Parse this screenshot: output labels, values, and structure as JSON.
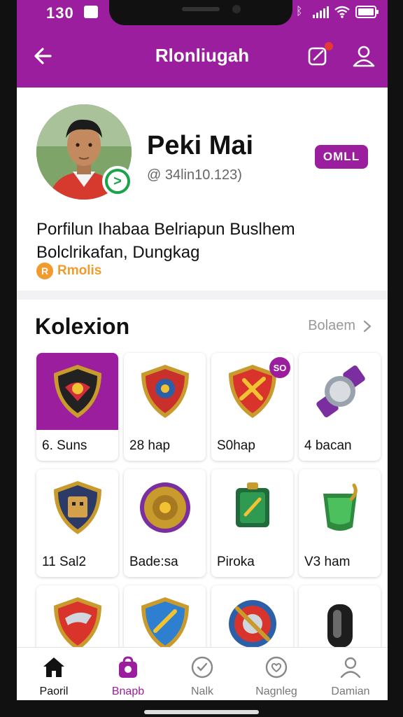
{
  "status_bar": {
    "time": "130"
  },
  "app_bar": {
    "title": "Rlonliugah"
  },
  "profile": {
    "name": "Peki Mai",
    "handle": "@ 34lin10.123)",
    "chip_label": "OMLL",
    "bio_line_1": "Porfilun Ihabaa Belriapun Buslhem",
    "bio_line_2": "Bolclrikafan, Dungkag",
    "tag_label": "Rmolis"
  },
  "collection": {
    "title": "Kolexion",
    "see_all": "Bolaem",
    "items": [
      {
        "label": "6. Suns",
        "badge": ""
      },
      {
        "label": "28  hap",
        "badge": ""
      },
      {
        "label": "S0hap",
        "badge": "SO"
      },
      {
        "label": "4 bacan",
        "badge": ""
      },
      {
        "label": "11 Sal2",
        "badge": ""
      },
      {
        "label": "Bade:sa",
        "badge": ""
      },
      {
        "label": "Piroka",
        "badge": ""
      },
      {
        "label": "V3 ham",
        "badge": ""
      },
      {
        "label": "",
        "badge": ""
      },
      {
        "label": "",
        "badge": ""
      },
      {
        "label": "",
        "badge": ""
      },
      {
        "label": "",
        "badge": ""
      }
    ]
  },
  "bottom_nav": [
    {
      "label": "Paoril",
      "icon": "home-icon"
    },
    {
      "label": "Bnapb",
      "icon": "bag-icon"
    },
    {
      "label": "Nalk",
      "icon": "check-circle-icon"
    },
    {
      "label": "Nagnleg",
      "icon": "heart-circle-icon"
    },
    {
      "label": "Damian",
      "icon": "user-icon"
    }
  ],
  "colors": {
    "accent": "#9a1e9e",
    "verified": "#19a34a",
    "tag": "#f29b2c"
  }
}
